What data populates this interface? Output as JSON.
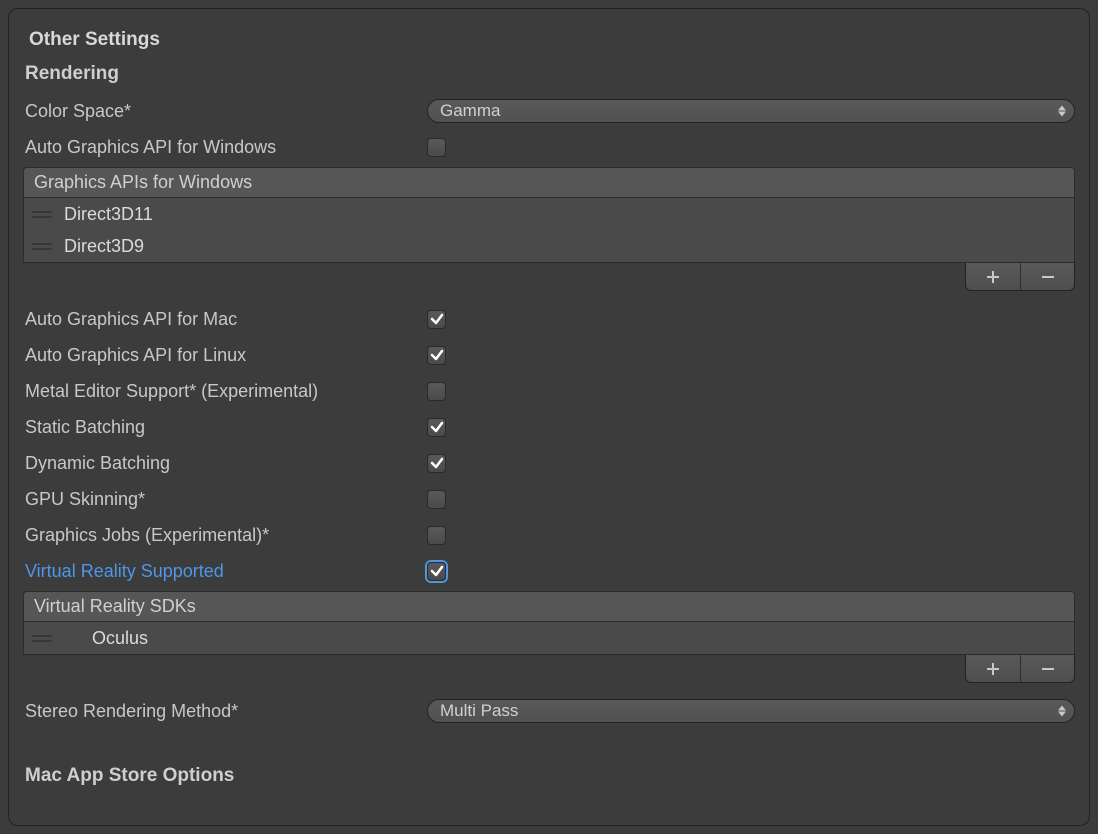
{
  "section_title": "Other Settings",
  "rendering": {
    "title": "Rendering",
    "color_space_label": "Color Space*",
    "color_space_value": "Gamma",
    "auto_gfx_windows_label": "Auto Graphics API for Windows",
    "auto_gfx_windows_checked": false,
    "gfx_apis_windows_header": "Graphics APIs for Windows",
    "gfx_apis_windows_items": [
      "Direct3D11",
      "Direct3D9"
    ],
    "auto_gfx_mac_label": "Auto Graphics API for Mac",
    "auto_gfx_mac_checked": true,
    "auto_gfx_linux_label": "Auto Graphics API for Linux",
    "auto_gfx_linux_checked": true,
    "metal_label": "Metal Editor Support* (Experimental)",
    "metal_checked": false,
    "static_batching_label": "Static Batching",
    "static_batching_checked": true,
    "dynamic_batching_label": "Dynamic Batching",
    "dynamic_batching_checked": true,
    "gpu_skinning_label": "GPU Skinning*",
    "gpu_skinning_checked": false,
    "graphics_jobs_label": "Graphics Jobs (Experimental)*",
    "graphics_jobs_checked": false,
    "vr_supported_label": "Virtual Reality Supported",
    "vr_supported_checked": true,
    "vr_sdks_header": "Virtual Reality SDKs",
    "vr_sdks_items": [
      "Oculus"
    ],
    "stereo_label": "Stereo Rendering Method*",
    "stereo_value": "Multi Pass"
  },
  "mac_app_store_title": "Mac App Store Options"
}
